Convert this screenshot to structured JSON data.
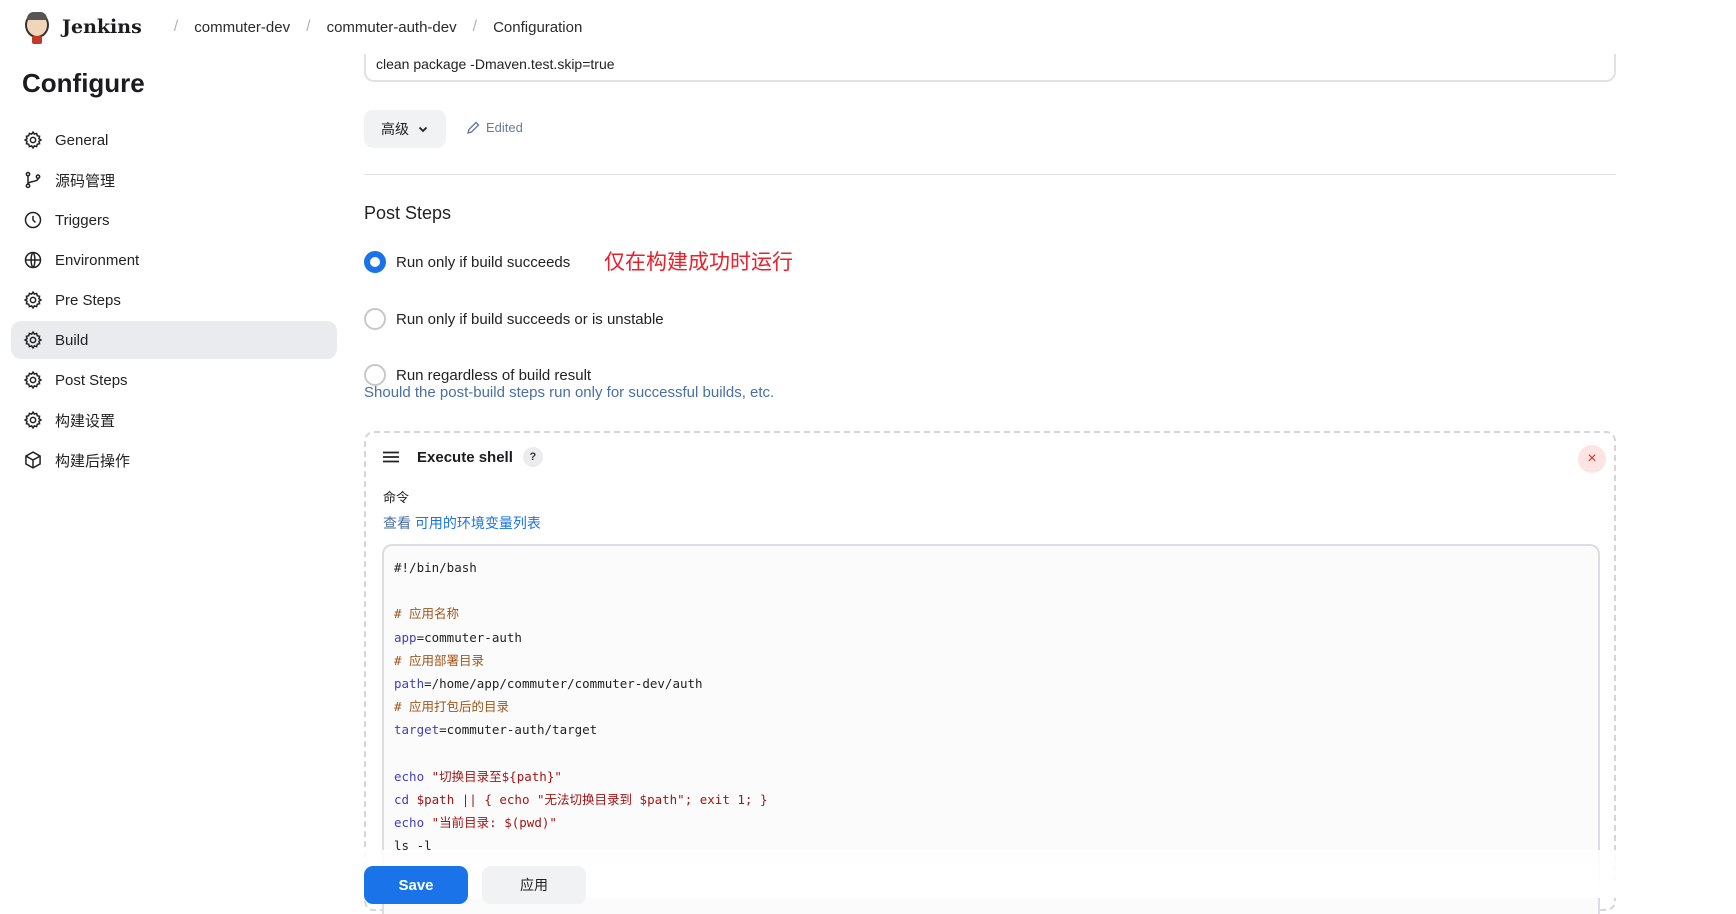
{
  "header": {
    "brand": "Jenkins",
    "breadcrumbs": [
      "commuter-dev",
      "commuter-auth-dev",
      "Configuration"
    ]
  },
  "sidebar": {
    "title": "Configure",
    "items": [
      {
        "label": "General",
        "icon": "gear-icon"
      },
      {
        "label": "源码管理",
        "icon": "branch-icon"
      },
      {
        "label": "Triggers",
        "icon": "clock-icon"
      },
      {
        "label": "Environment",
        "icon": "globe-icon"
      },
      {
        "label": "Pre Steps",
        "icon": "gear-icon"
      },
      {
        "label": "Build",
        "icon": "gear-icon",
        "active": true
      },
      {
        "label": "Post Steps",
        "icon": "gear-icon"
      },
      {
        "label": "构建设置",
        "icon": "gear-icon"
      },
      {
        "label": "构建后操作",
        "icon": "cube-icon"
      }
    ]
  },
  "build": {
    "goals_value": "clean package -Dmaven.test.skip=true",
    "advanced_label": "高级",
    "edited_label": "Edited"
  },
  "post_steps": {
    "title": "Post Steps",
    "options": [
      {
        "label": "Run only if build succeeds",
        "selected": true
      },
      {
        "label": "Run only if build succeeds or is unstable",
        "selected": false
      },
      {
        "label": "Run regardless of build result",
        "selected": false
      }
    ],
    "annotation": "仅在构建成功时运行",
    "help": "Should the post-build steps run only for successful builds, etc."
  },
  "execute_shell": {
    "title": "Execute shell",
    "help_label": "?",
    "close_label": "×",
    "command_label": "命令",
    "env_prefix": "查看 ",
    "env_link": "可用的环境变量列表"
  },
  "script_lines": [
    "#!/bin/bash",
    "",
    "# 应用名称",
    "app=commuter-auth",
    "# 应用部署目录",
    "path=/home/app/commuter/commuter-dev/auth",
    "# 应用打包后的目录",
    "target=commuter-auth/target",
    "",
    "echo \"切换目录至${path}\"",
    "cd $path || { echo \"无法切换目录到 $path\"; exit 1; }",
    "echo \"当前目录: $(pwd)\"",
    "ls -l"
  ],
  "footer": {
    "save_label": "Save",
    "apply_label": "应用"
  },
  "colors": {
    "primary": "#1a73e8",
    "annotation": "#e8212b",
    "help_text": "#4a6fa5"
  }
}
